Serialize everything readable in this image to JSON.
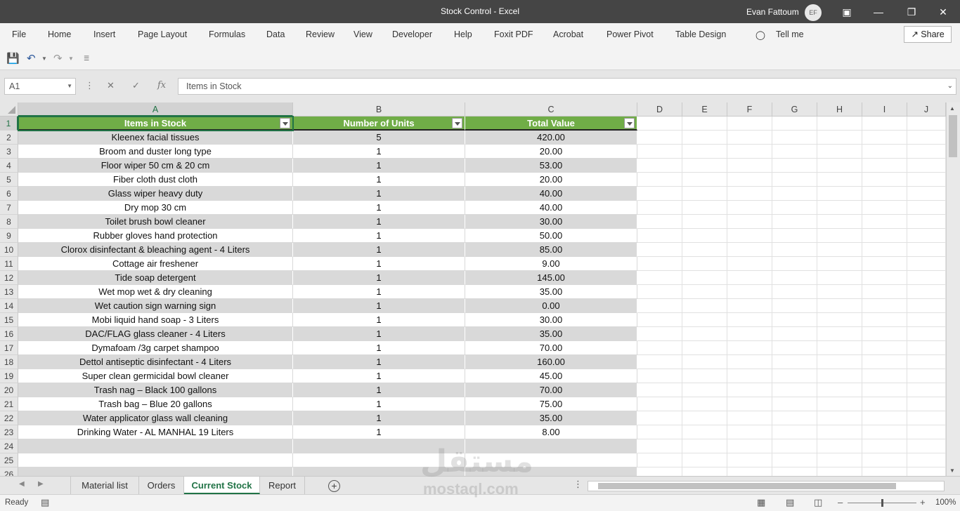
{
  "window": {
    "title": "Stock Control  -  Excel",
    "user_name": "Evan Fattoum",
    "user_initials": "EF",
    "share_label": "Share"
  },
  "ribbon": {
    "tabs": [
      "File",
      "Home",
      "Insert",
      "Page Layout",
      "Formulas",
      "Data",
      "Review",
      "View",
      "Developer",
      "Help",
      "Foxit PDF",
      "Acrobat",
      "Power Pivot",
      "Table Design"
    ],
    "tell_me": "Tell me"
  },
  "formula_bar": {
    "name_box": "A1",
    "fx_label": "fx",
    "formula": "Items in Stock"
  },
  "grid": {
    "columns": [
      "A",
      "B",
      "C",
      "D",
      "E",
      "F",
      "G",
      "H",
      "I",
      "J"
    ],
    "header_row": [
      "Items in Stock",
      "Number of Units",
      "Total Value"
    ],
    "rows": [
      [
        "Kleenex facial tissues",
        "5",
        "420.00"
      ],
      [
        "Broom and duster long type",
        "1",
        "20.00"
      ],
      [
        "Floor wiper 50 cm & 20 cm",
        "1",
        "53.00"
      ],
      [
        "Fiber cloth dust cloth",
        "1",
        "20.00"
      ],
      [
        "Glass wiper heavy duty",
        "1",
        "40.00"
      ],
      [
        "Dry mop 30 cm",
        "1",
        "40.00"
      ],
      [
        "Toilet brush bowl cleaner",
        "1",
        "30.00"
      ],
      [
        "Rubber gloves hand protection",
        "1",
        "50.00"
      ],
      [
        "Clorox disinfectant & bleaching agent - 4 Liters",
        "1",
        "85.00"
      ],
      [
        "Cottage air freshener",
        "1",
        "9.00"
      ],
      [
        "Tide soap detergent",
        "1",
        "145.00"
      ],
      [
        "Wet mop wet & dry cleaning",
        "1",
        "35.00"
      ],
      [
        "Wet caution sign warning sign",
        "1",
        "0.00"
      ],
      [
        "Mobi liquid hand soap - 3 Liters",
        "1",
        "30.00"
      ],
      [
        "DAC/FLAG glass cleaner - 4 Liters",
        "1",
        "35.00"
      ],
      [
        "Dymafoam /3g carpet shampoo",
        "1",
        "70.00"
      ],
      [
        "Dettol antiseptic disinfectant - 4 Liters",
        "1",
        "160.00"
      ],
      [
        "Super clean germicidal bowl cleaner",
        "1",
        "45.00"
      ],
      [
        "Trash nag – Black 100 gallons",
        "1",
        "70.00"
      ],
      [
        "Trash bag – Blue 20 gallons",
        "1",
        "75.00"
      ],
      [
        "Water applicator glass wall cleaning",
        "1",
        "35.00"
      ],
      [
        "Drinking Water - AL MANHAL 19 Liters",
        "1",
        "8.00"
      ]
    ],
    "row_numbers": [
      "1",
      "2",
      "3",
      "4",
      "5",
      "6",
      "7",
      "8",
      "9",
      "10",
      "11",
      "12",
      "13",
      "14",
      "15",
      "16",
      "17",
      "18",
      "19",
      "20",
      "21",
      "22",
      "23",
      "24",
      "25",
      "26"
    ]
  },
  "sheets": {
    "tabs": [
      "Material list",
      "Orders",
      "Current Stock",
      "Report"
    ],
    "active": "Current Stock"
  },
  "status": {
    "ready": "Ready",
    "zoom": "100%"
  },
  "watermark": {
    "arabic": "مستقل",
    "latin": "mostaql.com"
  },
  "colors": {
    "accent": "#217346",
    "table_header": "#70ad47",
    "band": "#d9d9d9",
    "titlebar": "#454545"
  }
}
